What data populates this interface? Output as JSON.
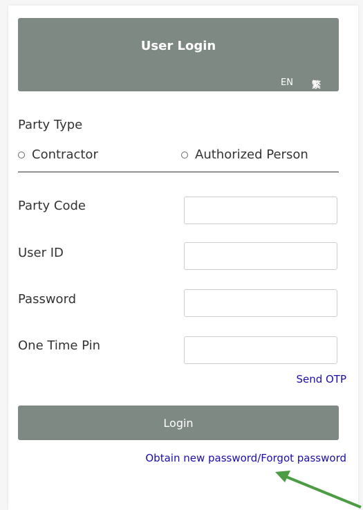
{
  "colors": {
    "header_bg": "#7e8983",
    "button_bg": "#7e8983",
    "link": "#1a0dab",
    "arrow": "#4c9c43"
  },
  "header": {
    "title": "User Login",
    "lang_en": "EN",
    "lang_tc": "繁"
  },
  "party_type": {
    "label": "Party Type",
    "options": [
      "Contractor",
      "Authorized Person"
    ]
  },
  "fields": {
    "party_code": {
      "label": "Party Code",
      "value": "",
      "placeholder": ""
    },
    "user_id": {
      "label": "User ID",
      "value": "",
      "placeholder": ""
    },
    "password": {
      "label": "Password",
      "value": "",
      "placeholder": ""
    },
    "otp": {
      "label": "One Time Pin",
      "value": "",
      "placeholder": ""
    }
  },
  "send_otp": "Send OTP",
  "login_button": "Login",
  "forgot_link": "Obtain new password/Forgot password"
}
